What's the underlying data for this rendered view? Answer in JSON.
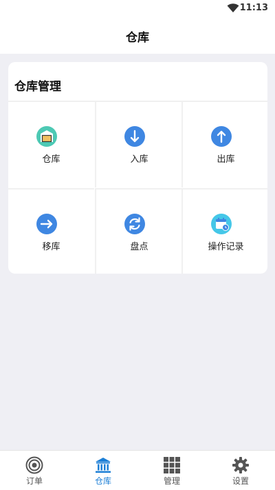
{
  "status_bar": {
    "time": "11:13",
    "wifi_icon": "wifi-icon"
  },
  "header": {
    "title": "仓库"
  },
  "card": {
    "title": "仓库管理",
    "items": [
      {
        "label": "仓库",
        "icon": "warehouse-icon"
      },
      {
        "label": "入库",
        "icon": "arrow-down-icon"
      },
      {
        "label": "出库",
        "icon": "arrow-up-icon"
      },
      {
        "label": "移库",
        "icon": "arrow-right-icon"
      },
      {
        "label": "盘点",
        "icon": "refresh-icon"
      },
      {
        "label": "操作记录",
        "icon": "calendar-record-icon"
      }
    ]
  },
  "tabbar": {
    "active_index": 1,
    "active_color": "#1d7fd6",
    "tabs": [
      {
        "label": "订单",
        "icon": "target-icon"
      },
      {
        "label": "仓库",
        "icon": "bank-icon"
      },
      {
        "label": "管理",
        "icon": "grid-icon"
      },
      {
        "label": "设置",
        "icon": "gear-icon"
      }
    ]
  },
  "colors": {
    "icon_blue": "#3f87e2",
    "warehouse_green": "#4dc9b4",
    "warehouse_box": "#f2c060",
    "record_cyan": "#45c7e8",
    "background": "#efeff4"
  }
}
